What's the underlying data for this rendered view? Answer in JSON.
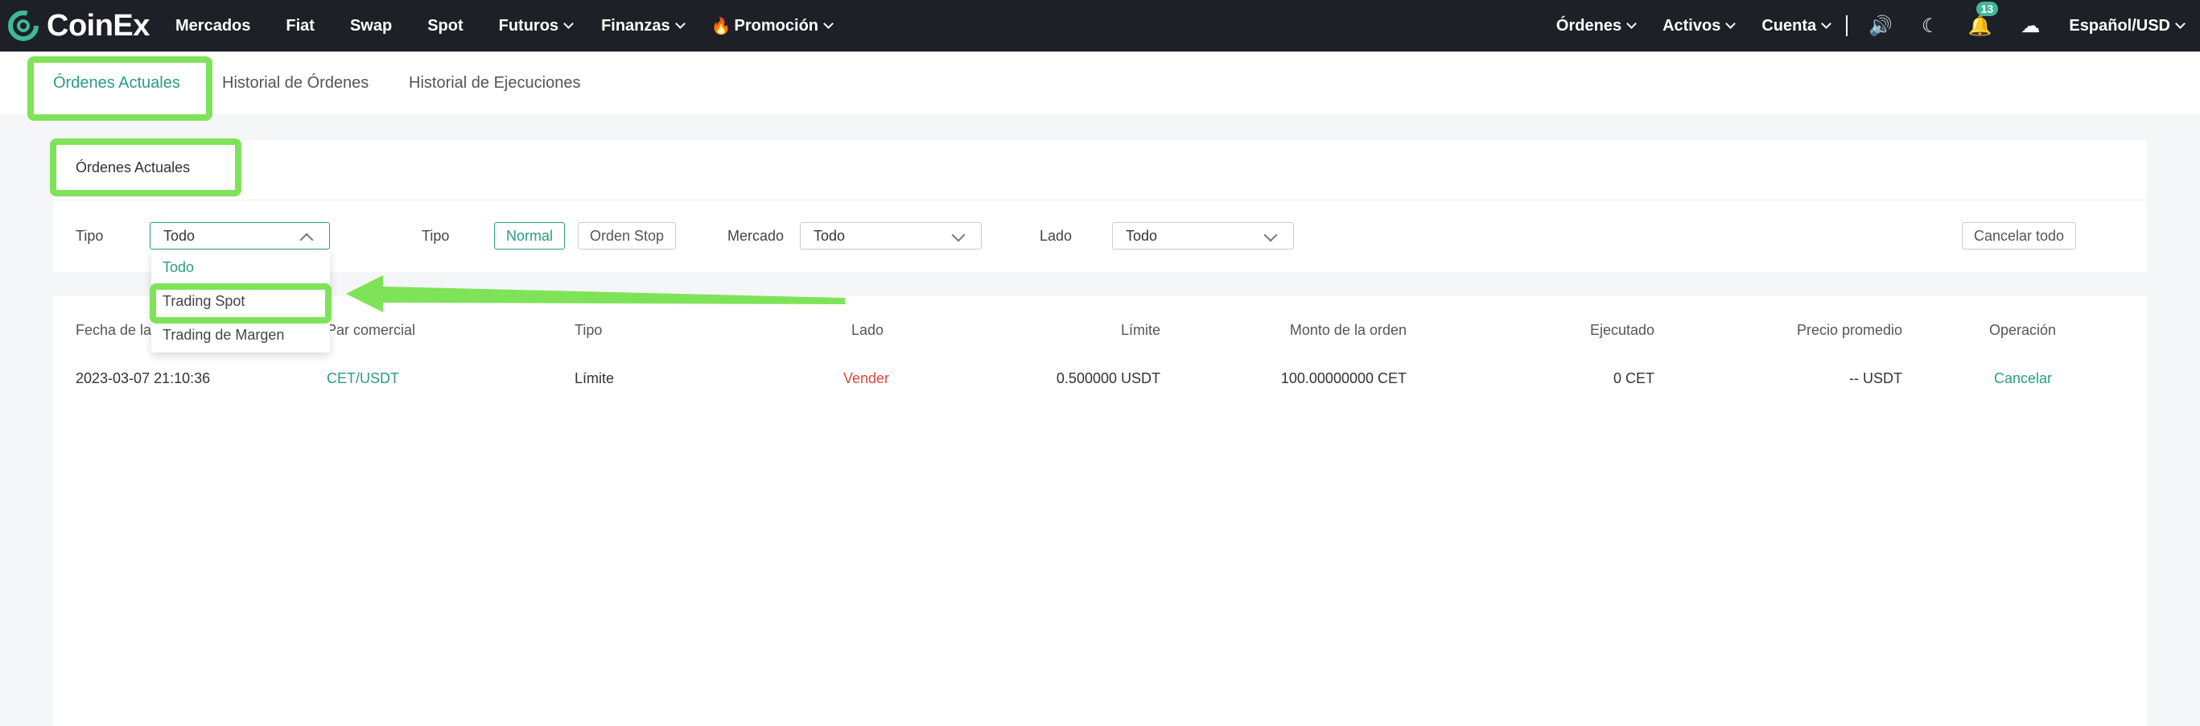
{
  "brand": {
    "name": "CoinEx"
  },
  "nav": {
    "left": [
      {
        "label": "Mercados",
        "dropdown": false
      },
      {
        "label": "Fiat",
        "dropdown": false
      },
      {
        "label": "Swap",
        "dropdown": false
      },
      {
        "label": "Spot",
        "dropdown": false
      },
      {
        "label": "Futuros",
        "dropdown": true
      },
      {
        "label": "Finanzas",
        "dropdown": true
      },
      {
        "label": "Promoción",
        "dropdown": true
      }
    ],
    "right": {
      "orders": "Órdenes",
      "assets": "Activos",
      "account": "Cuenta",
      "notifications_count": "13",
      "language": "Español/USD"
    }
  },
  "tabs": [
    "Órdenes Actuales",
    "Historial de Órdenes",
    "Historial de Ejecuciones"
  ],
  "section_title": "Órdenes Actuales",
  "filters": {
    "type_label": "Tipo",
    "type_value": "Todo",
    "type2_label": "Tipo",
    "normal_label": "Normal",
    "stop_label": "Orden Stop",
    "market_label": "Mercado",
    "market_value": "Todo",
    "side_label": "Lado",
    "side_value": "Todo",
    "cancel_all": "Cancelar todo"
  },
  "dropdown_options": [
    "Todo",
    "Trading Spot",
    "Trading de Margen"
  ],
  "table": {
    "headers": [
      "Fecha de la",
      "Par comercial",
      "Tipo",
      "Lado",
      "Límite",
      "Monto de la orden",
      "Ejecutado",
      "Precio promedio",
      "Operación"
    ],
    "rows": [
      [
        "2023-03-07 21:10:36",
        "CET/USDT",
        "Límite",
        "Vender",
        "0.500000 USDT",
        "100.00000000 CET",
        "0 CET",
        "-- USDT",
        "Cancelar"
      ]
    ]
  },
  "colors": {
    "accent": "#2a9d7f",
    "highlight": "#7fe35a",
    "sell": "#e0463c",
    "nav_bg": "#1d2027"
  }
}
